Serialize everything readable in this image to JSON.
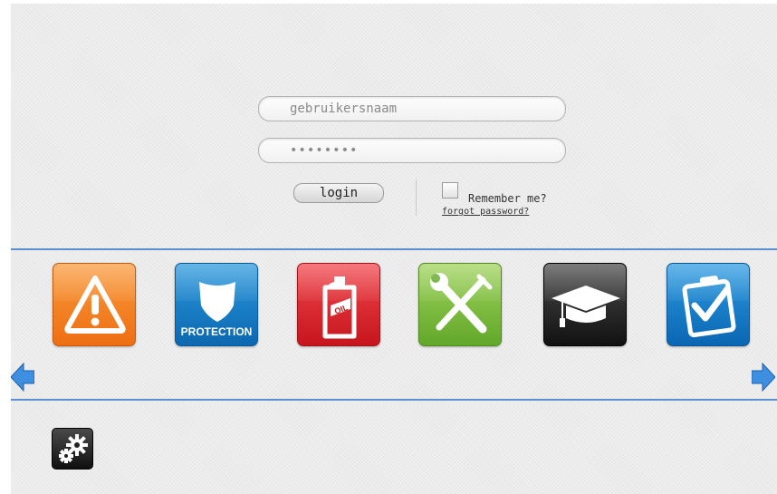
{
  "login_form": {
    "username_placeholder": "gebruikersnaam",
    "password_value": "********",
    "login_label": "login",
    "remember_label": "Remember me?",
    "forgot_label": "forgot password?"
  },
  "tiles": [
    {
      "name": "warning",
      "icon": "warning-triangle-icon",
      "color": "#ee6f12"
    },
    {
      "name": "protection",
      "icon": "shield-icon",
      "label": "PROTECTION",
      "color": "#0c68b0"
    },
    {
      "name": "oil",
      "icon": "oil-can-icon",
      "color": "#c6151d"
    },
    {
      "name": "tools",
      "icon": "wrench-screwdriver-icon",
      "color": "#62a82a"
    },
    {
      "name": "education",
      "icon": "graduation-cap-icon",
      "color": "#111111"
    },
    {
      "name": "checklist",
      "icon": "checklist-icon",
      "color": "#0a66b3"
    }
  ],
  "navigation": {
    "prev_icon": "arrow-left-icon",
    "next_icon": "arrow-right-icon"
  },
  "settings": {
    "icon": "gears-icon"
  },
  "colors": {
    "background": "#ebebeb",
    "divider": "#5d8fd0",
    "arrow": "#3f8fe0"
  }
}
